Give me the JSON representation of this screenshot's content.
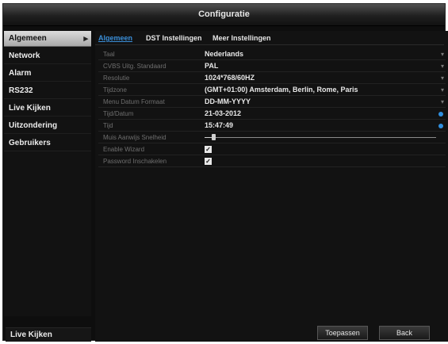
{
  "window": {
    "title": "Configuratie"
  },
  "sidebar": {
    "items": [
      {
        "label": "Algemeen",
        "active": true
      },
      {
        "label": "Network"
      },
      {
        "label": "Alarm"
      },
      {
        "label": "RS232"
      },
      {
        "label": "Live Kijken"
      },
      {
        "label": "Uitzondering"
      },
      {
        "label": "Gebruikers"
      }
    ],
    "bottom_label": "Live Kijken"
  },
  "tabs": [
    {
      "label": "Algemeen",
      "active": true
    },
    {
      "label": "DST Instellingen"
    },
    {
      "label": "Meer Instellingen"
    }
  ],
  "settings": [
    {
      "label": "Taal",
      "value": "Nederlands",
      "control": "dropdown"
    },
    {
      "label": "CVBS Uitg. Standaard",
      "value": "PAL",
      "control": "dropdown"
    },
    {
      "label": "Resolutie",
      "value": "1024*768/60HZ",
      "control": "dropdown"
    },
    {
      "label": "Tijdzone",
      "value": "(GMT+01:00) Amsterdam, Berlin, Rome, Paris",
      "control": "dropdown"
    },
    {
      "label": "Menu Datum Formaat",
      "value": "DD-MM-YYYY",
      "control": "dropdown"
    },
    {
      "label": "Tijd/Datum",
      "value": "21-03-2012",
      "control": "picker"
    },
    {
      "label": "Tijd",
      "value": "15:47:49",
      "control": "picker"
    },
    {
      "label": "Muis Aanwijs Snelheid",
      "control": "slider",
      "level": 0.03
    },
    {
      "label": "Enable Wizard",
      "control": "checkbox",
      "checked": true
    },
    {
      "label": "Password Inschakelen",
      "control": "checkbox",
      "checked": true
    }
  ],
  "buttons": {
    "apply": "Toepassen",
    "back": "Back"
  },
  "icons": {
    "dropdown": "chevron-down-icon",
    "picker": "blue-dot-icon",
    "sidebar_active": "chevron-right-icon"
  },
  "colors": {
    "accent": "#3a8ed8",
    "picker_dot": "#2f8fe0"
  }
}
